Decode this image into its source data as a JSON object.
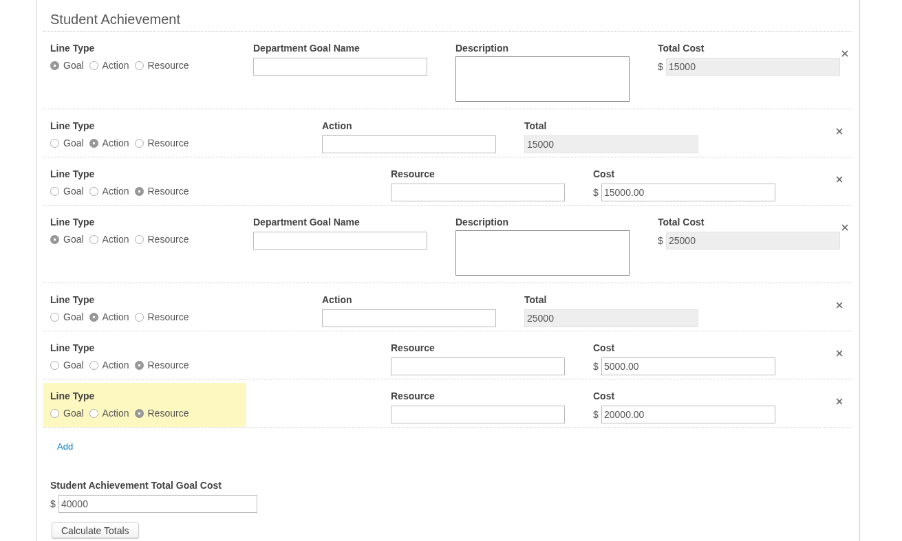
{
  "section": {
    "title": "Student Achievement"
  },
  "lines": [
    {
      "kind": "goal",
      "highlighted": false,
      "line_type_label": "Line Type",
      "options": [
        {
          "label": "Goal",
          "selected": true
        },
        {
          "label": "Action",
          "selected": false
        },
        {
          "label": "Resource",
          "selected": false
        }
      ],
      "fields": [
        {
          "kind": "input",
          "label": "Department Goal Name"
        },
        {
          "kind": "textarea",
          "label": "Description"
        },
        {
          "kind": "input",
          "label": "Total Cost",
          "prefix": "$",
          "value": "15000",
          "readonly": true
        }
      ]
    },
    {
      "kind": "action",
      "highlighted": false,
      "line_type_label": "Line Type",
      "options": [
        {
          "label": "Goal",
          "selected": false
        },
        {
          "label": "Action",
          "selected": true
        },
        {
          "label": "Resource",
          "selected": false
        }
      ],
      "fields": [
        {
          "kind": "input",
          "label": "Action"
        },
        {
          "kind": "input",
          "label": "Total",
          "value": "15000",
          "readonly": true
        }
      ]
    },
    {
      "kind": "resource",
      "highlighted": false,
      "line_type_label": "Line Type",
      "options": [
        {
          "label": "Goal",
          "selected": false
        },
        {
          "label": "Action",
          "selected": false
        },
        {
          "label": "Resource",
          "selected": true
        }
      ],
      "fields": [
        {
          "kind": "input",
          "label": "Resource"
        },
        {
          "kind": "input",
          "label": "Cost",
          "prefix": "$",
          "value": "15000.00",
          "readonly": false
        }
      ]
    },
    {
      "kind": "goal",
      "highlighted": false,
      "line_type_label": "Line Type",
      "options": [
        {
          "label": "Goal",
          "selected": true
        },
        {
          "label": "Action",
          "selected": false
        },
        {
          "label": "Resource",
          "selected": false
        }
      ],
      "fields": [
        {
          "kind": "input",
          "label": "Department Goal Name"
        },
        {
          "kind": "textarea",
          "label": "Description"
        },
        {
          "kind": "input",
          "label": "Total Cost",
          "prefix": "$",
          "value": "25000",
          "readonly": true
        }
      ]
    },
    {
      "kind": "action",
      "highlighted": false,
      "line_type_label": "Line Type",
      "options": [
        {
          "label": "Goal",
          "selected": false
        },
        {
          "label": "Action",
          "selected": true
        },
        {
          "label": "Resource",
          "selected": false
        }
      ],
      "fields": [
        {
          "kind": "input",
          "label": "Action"
        },
        {
          "kind": "input",
          "label": "Total",
          "value": "25000",
          "readonly": true
        }
      ]
    },
    {
      "kind": "resource",
      "highlighted": false,
      "line_type_label": "Line Type",
      "options": [
        {
          "label": "Goal",
          "selected": false
        },
        {
          "label": "Action",
          "selected": false
        },
        {
          "label": "Resource",
          "selected": true
        }
      ],
      "fields": [
        {
          "kind": "input",
          "label": "Resource"
        },
        {
          "kind": "input",
          "label": "Cost",
          "prefix": "$",
          "value": "5000.00",
          "readonly": false
        }
      ]
    },
    {
      "kind": "resource",
      "highlighted": true,
      "line_type_label": "Line Type",
      "options": [
        {
          "label": "Goal",
          "selected": false
        },
        {
          "label": "Action",
          "selected": false
        },
        {
          "label": "Resource",
          "selected": true
        }
      ],
      "fields": [
        {
          "kind": "input",
          "label": "Resource"
        },
        {
          "kind": "input",
          "label": "Cost",
          "prefix": "$",
          "value": "20000.00",
          "readonly": false
        }
      ]
    }
  ],
  "add_link": "Add",
  "total": {
    "label": "Student Achievement Total Goal Cost",
    "prefix": "$",
    "value": "40000"
  },
  "calculate_button": "Calculate Totals"
}
